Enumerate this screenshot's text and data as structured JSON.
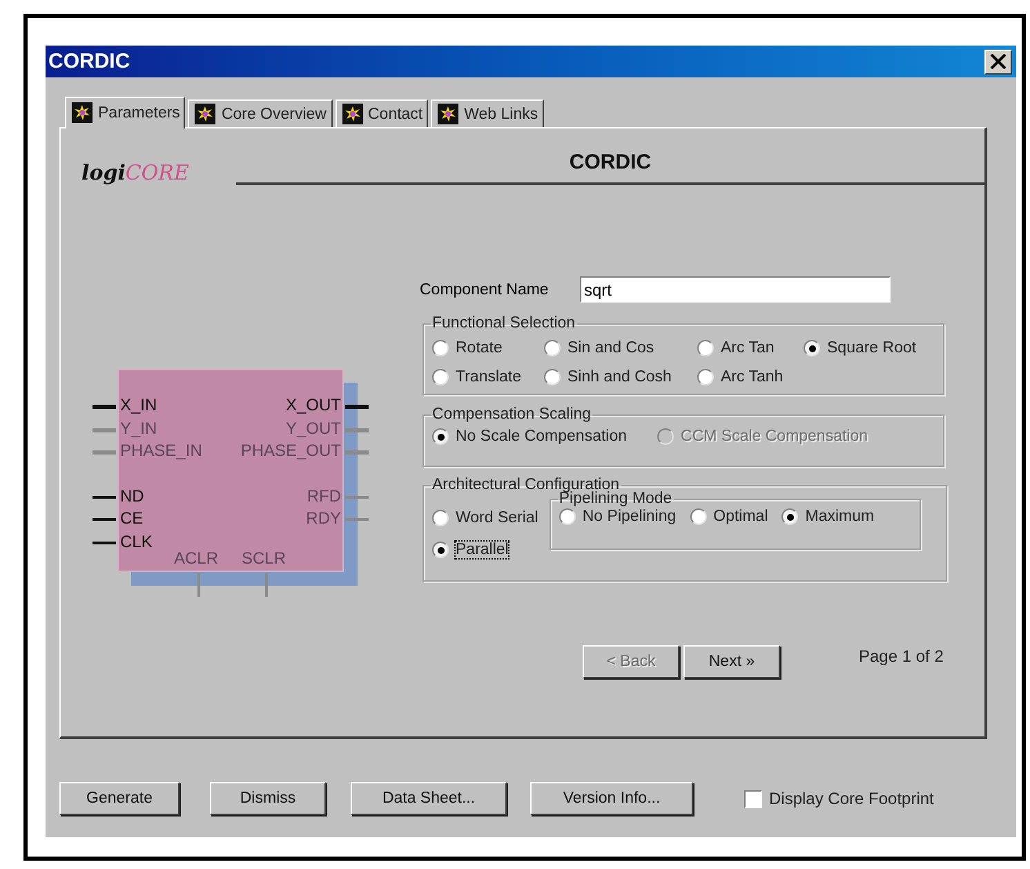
{
  "window": {
    "title": "CORDIC"
  },
  "tabs": [
    {
      "label": "Parameters",
      "selected": true
    },
    {
      "label": "Core Overview",
      "selected": false
    },
    {
      "label": "Contact",
      "selected": false
    },
    {
      "label": "Web Links",
      "selected": false
    }
  ],
  "header": {
    "logo_prefix": "logi",
    "logo_suffix": "CORE",
    "title": "CORDIC"
  },
  "symbol": {
    "left_pin_groups": [
      {
        "kind": "data",
        "pins": [
          {
            "label": "X_IN",
            "active": true
          },
          {
            "label": "Y_IN",
            "active": false
          },
          {
            "label": "PHASE_IN",
            "active": false
          }
        ]
      },
      {
        "kind": "control",
        "pins": [
          {
            "label": "ND",
            "active": true
          },
          {
            "label": "CE",
            "active": true
          },
          {
            "label": "CLK",
            "active": true
          }
        ]
      }
    ],
    "right_pin_groups": [
      {
        "kind": "data",
        "pins": [
          {
            "label": "X_OUT",
            "active": true
          },
          {
            "label": "Y_OUT",
            "active": false
          },
          {
            "label": "PHASE_OUT",
            "active": false
          }
        ]
      },
      {
        "kind": "control",
        "pins": [
          {
            "label": "RFD",
            "active": false
          },
          {
            "label": "RDY",
            "active": false
          }
        ]
      }
    ],
    "bottom_pins": [
      {
        "label": "ACLR",
        "active": false
      },
      {
        "label": "SCLR",
        "active": false
      }
    ]
  },
  "component_name": {
    "label": "Component Name",
    "value": "sqrt"
  },
  "functional_selection": {
    "title": "Functional Selection",
    "options": [
      {
        "label": "Rotate",
        "selected": false
      },
      {
        "label": "Sin and Cos",
        "selected": false
      },
      {
        "label": "Arc Tan",
        "selected": false
      },
      {
        "label": "Square Root",
        "selected": true
      },
      {
        "label": "Translate",
        "selected": false
      },
      {
        "label": "Sinh and Cosh",
        "selected": false
      },
      {
        "label": "Arc Tanh",
        "selected": false
      }
    ]
  },
  "compensation_scaling": {
    "title": "Compensation Scaling",
    "options": [
      {
        "label": "No Scale Compensation",
        "selected": true,
        "disabled": false
      },
      {
        "label": "CCM Scale Compensation",
        "selected": false,
        "disabled": true
      }
    ]
  },
  "architectural_configuration": {
    "title": "Architectural Configuration",
    "options": [
      {
        "label": "Word Serial",
        "selected": false,
        "focused": false
      },
      {
        "label": "Parallel",
        "selected": true,
        "focused": true
      }
    ],
    "pipelining_mode": {
      "title": "Pipelining Mode",
      "options": [
        {
          "label": "No Pipelining",
          "selected": false
        },
        {
          "label": "Optimal",
          "selected": false
        },
        {
          "label": "Maximum",
          "selected": true
        }
      ]
    }
  },
  "navigation": {
    "back": {
      "label": "< Back",
      "disabled": true
    },
    "next": {
      "label": "Next »",
      "disabled": false
    },
    "page": "Page 1 of 2"
  },
  "buttons": [
    "Generate",
    "Dismiss",
    "Data Sheet...",
    "Version Info..."
  ],
  "footprint": {
    "label": "Display Core Footprint",
    "checked": false
  }
}
